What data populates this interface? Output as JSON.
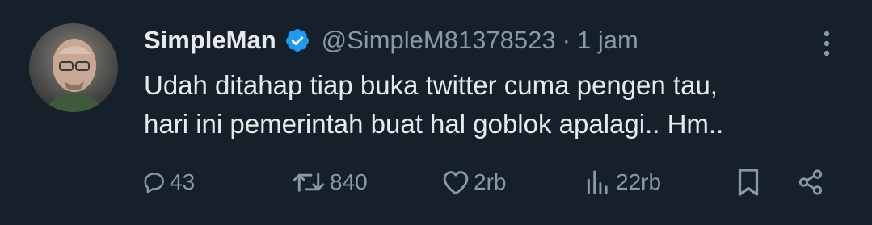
{
  "author": {
    "name": "SimpleMan",
    "handle": "@SimpleM81378523",
    "separator": "·",
    "time": "1 jam",
    "verified_color": "#1d9bf0"
  },
  "tweet": {
    "lines": [
      "Udah ditahap tiap buka twitter cuma pengen tau,",
      "hari ini pemerintah buat hal goblok apalagi.. Hm.."
    ]
  },
  "actions": {
    "replies": "43",
    "retweets": "840",
    "likes": "2rb",
    "views": "22rb"
  },
  "icons": {
    "more": "more-vertical-icon",
    "reply": "reply-bubble-icon",
    "retweet": "retweet-icon",
    "like": "heart-icon",
    "views": "bar-chart-icon",
    "bookmark": "bookmark-icon",
    "share": "share-icon"
  },
  "colors": {
    "background": "#15202b",
    "text": "#e7e9ea",
    "muted": "#8b98a5"
  }
}
